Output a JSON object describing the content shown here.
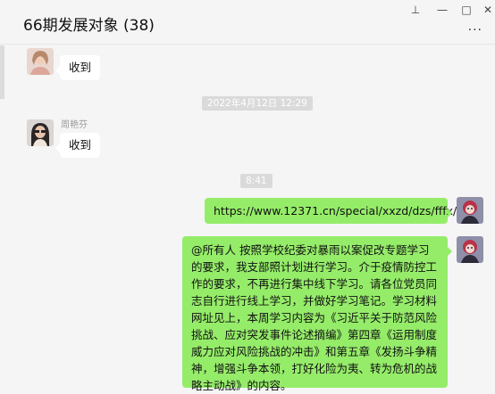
{
  "window": {
    "title": "66期发展对象 (38)",
    "pin_glyph": "⊥",
    "minimize_glyph": "—",
    "maximize_glyph": "□",
    "close_glyph": "✕",
    "more_glyph": "···"
  },
  "messages": [
    {
      "sender": "",
      "text": "收到"
    },
    {
      "sender": "周艳芬",
      "text": "收到"
    },
    {
      "text": "https://www.12371.cn/special/xxzd/dzs/fffx/"
    },
    {
      "text": "@所有人 按照学校纪委对暴雨以案促改专题学习的要求，我支部照计划进行学习。介于疫情防控工作的要求，不再进行集中线下学习。请各位党员同志自行进行线上学习，并做好学习笔记。学习材料网址见上，本周学习内容为《习近平关于防范风险挑战、应对突发事件论述摘编》第四章《运用制度威力应对风险挑战的冲击》和第五章《发扬斗争精神，增强斗争本领，打好化险为夷、转为危机的战略主动战》的内容。"
    }
  ],
  "timestamps": [
    "2022年4月12日 12:29",
    "8:41"
  ],
  "colors": {
    "own_bubble": "#95ec69",
    "other_bubble": "#ffffff",
    "background": "#f5f5f5"
  }
}
